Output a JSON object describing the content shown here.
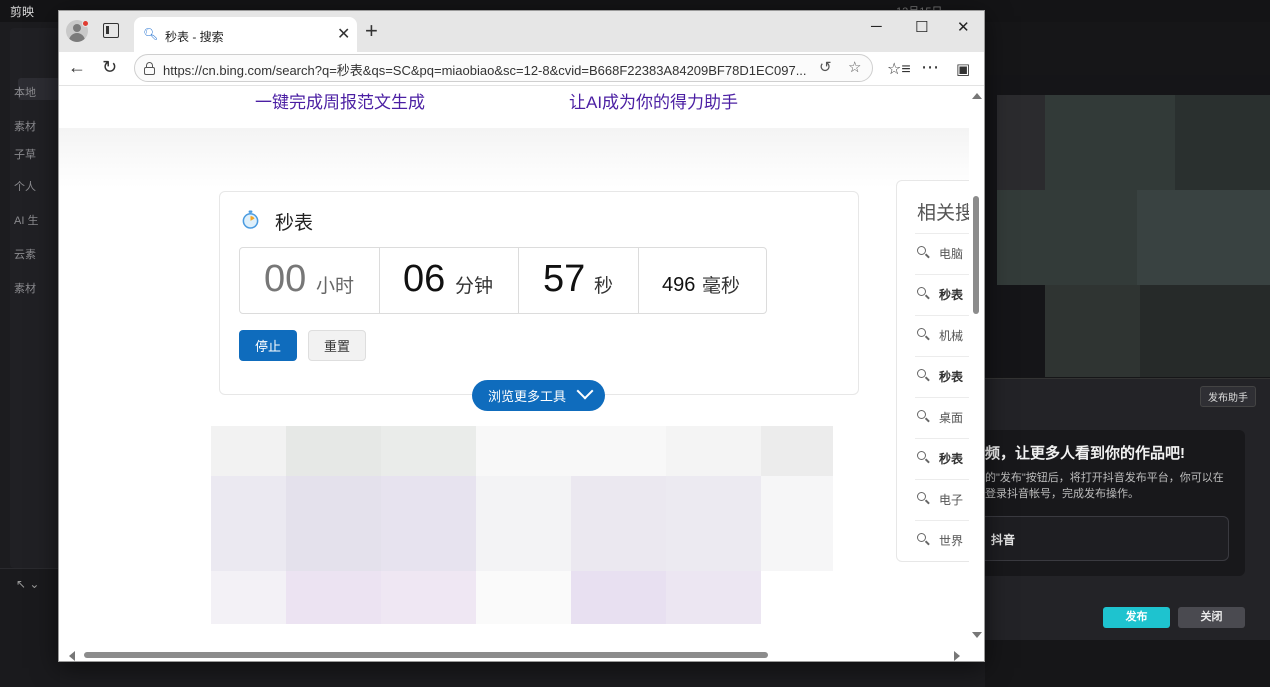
{
  "background_app": {
    "logo_text": "剪映",
    "date_text": "12月15日",
    "left_panel_items": [
      "本地",
      "素材",
      "子草",
      "个人",
      "AI 生",
      "云素",
      "素材"
    ],
    "publish_panel": {
      "assist_label": "发布助手",
      "title": "频，让更多人看到你的作品吧!",
      "description": "的\"发布\"按钮后，将打开抖音发布平台，你可以在登录抖音帐号，完成发布操作。",
      "platform_label": "抖音",
      "publish_button": "发布",
      "close_button": "关闭",
      "accent_color": "#1ec3cf"
    }
  },
  "browser": {
    "tab": {
      "title": "秒表 - 搜索",
      "favicon": "search-icon"
    },
    "new_tab_label": "+",
    "window_controls": {
      "minimize": "─",
      "maximize": "☐",
      "close": "✕"
    },
    "address_bar": {
      "url": "https://cn.bing.com/search?q=秒表&qs=SC&pq=miaobiao&sc=12-8&cvid=B668F22383A84209BF78D1EC097..."
    }
  },
  "page": {
    "banner_links": [
      "一键完成周报范文生成",
      "让AI成为你的得力助手"
    ],
    "stopwatch": {
      "title": "秒表",
      "hours": {
        "value": "00",
        "unit": "小时"
      },
      "minutes": {
        "value": "06",
        "unit": "分钟"
      },
      "seconds": {
        "value": "57",
        "unit": "秒"
      },
      "milliseconds": {
        "value": "496",
        "unit": "毫秒"
      },
      "stop_button": "停止",
      "reset_button": "重置",
      "primary_color": "#0f6cbd"
    },
    "more_tools_button": "浏览更多工具",
    "related_searches": {
      "title": "相关搜",
      "items": [
        {
          "text": "电脑",
          "bold": false
        },
        {
          "text": "秒表",
          "bold": true
        },
        {
          "text": "机械",
          "bold": false
        },
        {
          "text": "秒表",
          "bold": true
        },
        {
          "text": "桌面",
          "bold": false
        },
        {
          "text": "秒表",
          "bold": true
        },
        {
          "text": "电子",
          "bold": false
        },
        {
          "text": "世界",
          "bold": false
        }
      ]
    }
  }
}
